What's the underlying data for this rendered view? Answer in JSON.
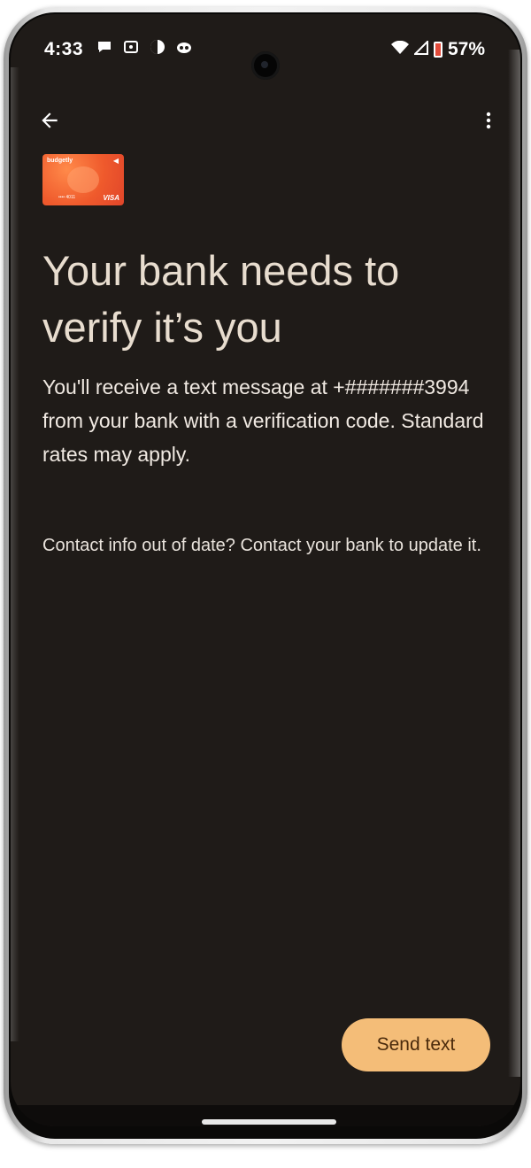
{
  "status_bar": {
    "time": "4:33",
    "left_icons": [
      "chat-bubble-icon",
      "notification-icon",
      "app-icon",
      "mascot-icon"
    ],
    "battery_percent": "57%",
    "battery_color": "#e34b3a"
  },
  "toolbar": {
    "back_icon": "arrow-back-icon",
    "more_icon": "more-vert-icon"
  },
  "card": {
    "brand": "budgetly",
    "network": "VISA",
    "number_hint": "•••• 4011"
  },
  "main": {
    "headline": "Your bank needs to verify it’s you",
    "body": "You'll receive a text message at +#######3994 from your bank with a verification code. Standard rates may apply.",
    "contact_info": "Contact info out of date? Contact your bank to update it."
  },
  "actions": {
    "send_text_label": "Send text",
    "button_color": "#f4bd78"
  },
  "theme": {
    "background": "#1f1b18",
    "headline_color": "#e8ddcf"
  }
}
